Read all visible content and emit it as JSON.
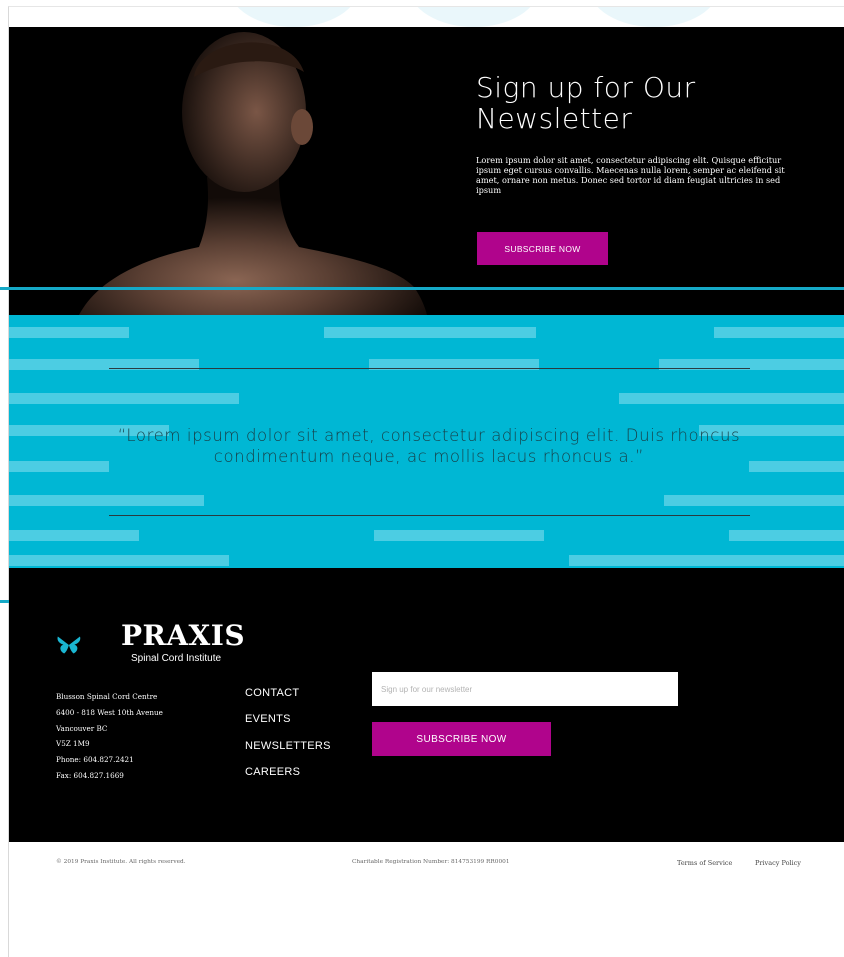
{
  "hero": {
    "title": "Sign up for Our Newsletter",
    "body": "Lorem ipsum dolor sit amet, consectetur adipiscing elit. Quisque efficitur ipsum eget cursus convallis. Maecenas nulla lorem, semper ac eleifend sit amet, ornare non metus. Donec sed tortor id diam feugiat ultricies in sed ipsum",
    "button_label": "SUBSCRIBE NOW"
  },
  "quote": {
    "text": "“Lorem ipsum dolor sit amet, consectetur adipiscing elit. Duis rhoncus condimentum neque, ac mollis lacus rhoncus a.”"
  },
  "footer": {
    "logo": {
      "name": "PRAXIS",
      "subtitle": "Spinal Cord Institute"
    },
    "address": [
      "Blusson Spinal Cord Centre",
      "6400 - 818 West 10th Avenue",
      "Vancouver BC",
      "V5Z 1M9",
      "Phone: 604.827.2421",
      "Fax: 604.827.1669"
    ],
    "nav": [
      "CONTACT",
      "EVENTS",
      "NEWSLETTERS",
      "CAREERS"
    ],
    "newsletter": {
      "placeholder": "Sign up for our newsletter",
      "button_label": "SUBSCRIBE NOW"
    }
  },
  "bottom": {
    "copyright": "© 2019 Praxis Institute. All rights reserved.",
    "charity": "Charitable Registration Number: 814753199 RR0001",
    "terms": "Terms of Service",
    "privacy": "Privacy Policy"
  },
  "colors": {
    "accent_magenta": "#b0048c",
    "cyan": "#00b7d4",
    "logo_cyan": "#1ab6d2"
  },
  "icons": [
    "butterfly-logo-icon"
  ]
}
